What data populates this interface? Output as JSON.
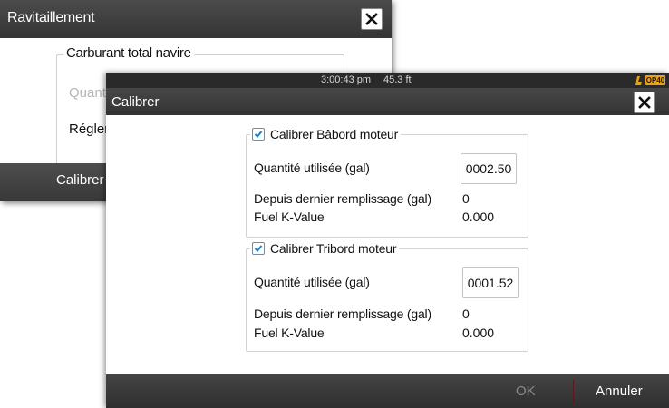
{
  "background_dialog": {
    "title": "Ravitaillement",
    "group_title": "Carburant total navire",
    "row1_label": "Quant",
    "row2_label": "Régler",
    "footer_button": "Calibrer"
  },
  "status": {
    "time": "3:00:43 pm",
    "depth": "45.3 ft",
    "badge": "OP40"
  },
  "dialog": {
    "title": "Calibrer",
    "groups": [
      {
        "title": "Calibrer Bâbord moteur",
        "checked": true,
        "quantity_label": "Quantité utilisée (gal)",
        "quantity_value": "0002.50",
        "since_label": "Depuis dernier remplissage (gal)",
        "since_value": "0",
        "kvalue_label": "Fuel K-Value",
        "kvalue_value": "0.000"
      },
      {
        "title": "Calibrer Tribord moteur",
        "checked": true,
        "quantity_label": "Quantité utilisée (gal)",
        "quantity_value": "0001.52",
        "since_label": "Depuis dernier remplissage (gal)",
        "since_value": "0",
        "kvalue_label": "Fuel K-Value",
        "kvalue_value": "0.000"
      }
    ],
    "ok_label": "OK",
    "cancel_label": "Annuler"
  },
  "icons": {
    "close": "close-icon",
    "checkbox": "checkmark-icon",
    "autopilot": "autopilot-icon"
  },
  "colors": {
    "checkmark": "#1a7fd4",
    "badge": "#e8a317",
    "titlebar": "#3d3d3d"
  }
}
